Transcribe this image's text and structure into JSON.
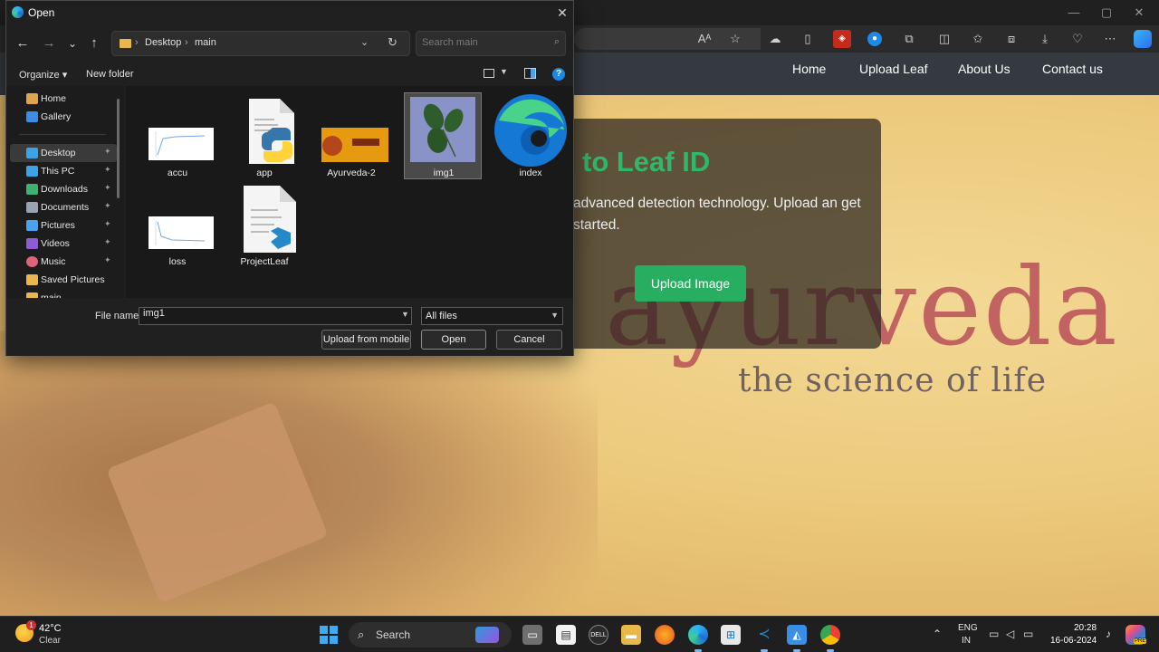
{
  "dialog": {
    "title": "Open",
    "close_glyph": "✕",
    "nav": {
      "back": "←",
      "forward": "→",
      "recent": "⌄",
      "up": "↑"
    },
    "breadcrumb": [
      "Desktop",
      "main"
    ],
    "breadcrumb_sep": "›",
    "search_placeholder": "Search main",
    "organize_label": "Organize ▾",
    "new_folder_label": "New folder",
    "help_glyph": "?",
    "nav_pane": [
      {
        "label": "Home",
        "icon": "home-icon",
        "color": "#e0a44a",
        "pinned": false
      },
      {
        "label": "Gallery",
        "icon": "gallery-icon",
        "color": "#3a8ee6",
        "pinned": false
      },
      {
        "label": "Desktop",
        "icon": "desktop-icon",
        "color": "#3ba3e8",
        "pinned": true
      },
      {
        "label": "This PC",
        "icon": "pc-icon",
        "color": "#3ba3e8",
        "pinned": true
      },
      {
        "label": "Downloads",
        "icon": "download-icon",
        "color": "#3cb371",
        "pinned": true
      },
      {
        "label": "Documents",
        "icon": "documents-icon",
        "color": "#9aa4b0",
        "pinned": true
      },
      {
        "label": "Pictures",
        "icon": "pictures-icon",
        "color": "#4aa3f0",
        "pinned": true
      },
      {
        "label": "Videos",
        "icon": "videos-icon",
        "color": "#8e5ad8",
        "pinned": true
      },
      {
        "label": "Music",
        "icon": "music-icon",
        "color": "#e0637a",
        "pinned": true
      },
      {
        "label": "Saved Pictures",
        "icon": "folder-icon",
        "color": "#e8b84a",
        "pinned": false
      },
      {
        "label": "main",
        "icon": "folder-icon",
        "color": "#e8b84a",
        "pinned": false
      }
    ],
    "pin_glyph": "📌",
    "files": [
      {
        "name": "accu",
        "kind": "chart-image",
        "selected": false
      },
      {
        "name": "app",
        "kind": "python-file",
        "selected": false
      },
      {
        "name": "Ayurveda-2",
        "kind": "banner-image",
        "selected": false
      },
      {
        "name": "img1",
        "kind": "leaf-image",
        "selected": true
      },
      {
        "name": "index",
        "kind": "edge-html",
        "selected": false
      },
      {
        "name": "loss",
        "kind": "chart-image",
        "selected": false
      },
      {
        "name": "ProjectLeaf",
        "kind": "vscode-project",
        "selected": false
      }
    ],
    "file_name_label": "File name:",
    "file_name_value": "img1",
    "file_type": "All files",
    "buttons": {
      "upload_mobile": "Upload from mobile",
      "open": "Open",
      "cancel": "Cancel"
    }
  },
  "browser": {
    "window_controls": {
      "minimize": "—",
      "maximize": "▢",
      "close": "✕"
    }
  },
  "site": {
    "nav": [
      "Home",
      "Upload Leaf",
      "About Us",
      "Contact us"
    ],
    "hero_title": "to Leaf ID",
    "hero_text": "advanced detection technology. Upload an get started.",
    "upload_button": "Upload Image",
    "logo_text": "ayurveda",
    "logo_tagline": "the science of life"
  },
  "taskbar": {
    "weather_temp": "42°C",
    "weather_cond": "Clear",
    "weather_badge": "1",
    "search_label": "Search",
    "lang_top": "ENG",
    "lang_bottom": "IN",
    "time": "20:28",
    "date": "16-06-2024"
  },
  "colors": {
    "accent_green": "#27ae60",
    "dialog_bg": "#202020",
    "nav_bg": "#343a40"
  }
}
